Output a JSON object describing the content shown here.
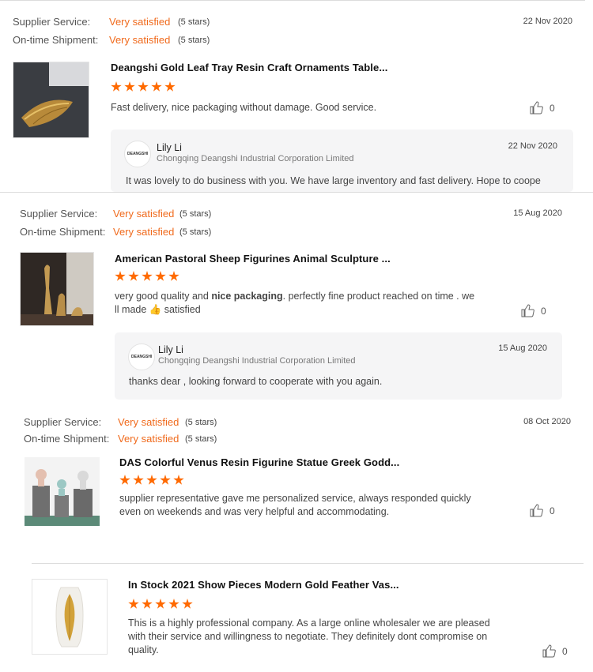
{
  "labels": {
    "supplier_service": "Supplier Service:",
    "ontime_shipment": "On-time Shipment:"
  },
  "reviews": [
    {
      "supplier_service": "Very satisfied",
      "supplier_stars": "(5 stars)",
      "shipment": "Very satisfied",
      "shipment_stars": "(5 stars)",
      "date": "22 Nov 2020",
      "product_title": "Deangshi Gold Leaf Tray Resin Craft Ornaments Table...",
      "rating": 5,
      "comment": "Fast delivery, nice packaging without damage. Good service.",
      "likes": "0",
      "reply": {
        "logo_text": "DEANGSHI",
        "name": "Lily Li",
        "company": "Chongqing Deangshi Industrial Corporation Limited",
        "date": "22 Nov 2020",
        "text": "It was lovely to do business with you. We have large inventory and fast delivery. Hope to coope"
      }
    },
    {
      "supplier_service": "Very satisfied",
      "supplier_stars": "(5 stars)",
      "shipment": "Very satisfied",
      "shipment_stars": "(5 stars)",
      "date": "15 Aug 2020",
      "product_title": "American Pastoral Sheep Figurines Animal Sculpture ...",
      "rating": 5,
      "comment_pre": "very good quality and ",
      "comment_bold": "nice packaging",
      "comment_post": ". perfectly fine product reached on time . we ll made 👍 satisfied",
      "likes": "0",
      "reply": {
        "logo_text": "DEANGSHI",
        "name": "Lily Li",
        "company": "Chongqing Deangshi Industrial Corporation Limited",
        "date": "15 Aug 2020",
        "text": "thanks dear , looking forward to cooperate with you again."
      }
    },
    {
      "supplier_service": "Very satisfied",
      "supplier_stars": "(5 stars)",
      "shipment": "Very satisfied",
      "shipment_stars": "(5 stars)",
      "date": "08 Oct 2020",
      "product_title": "DAS Colorful Venus Resin Figurine Statue Greek Godd...",
      "rating": 5,
      "comment": "supplier representative gave me personalized service, always responded quickly even on weekends and was very helpful and accommodating.",
      "likes": "0"
    },
    {
      "product_title": "In Stock 2021 Show Pieces Modern Gold Feather Vas...",
      "rating": 5,
      "comment": "This is a highly professional company. As a large online wholesaler we are pleased with their service and willingness to negotiate. They definitely dont compromise on quality.",
      "likes": "0"
    }
  ],
  "colors": {
    "accent": "#f06a1c",
    "star": "#ff6a00"
  }
}
